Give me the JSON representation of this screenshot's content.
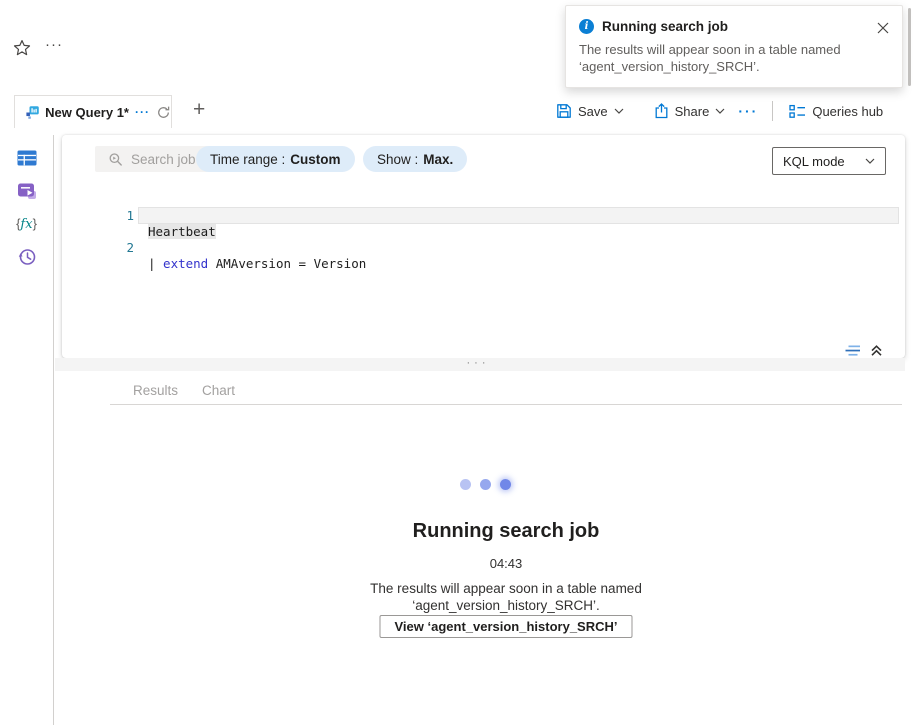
{
  "topbar": {
    "more": "···"
  },
  "toast": {
    "title": "Running search job",
    "line1": "The results will appear soon in a table named",
    "line2": "‘agent_version_history_SRCH’."
  },
  "tabbar": {
    "tab_label": "New Query 1*",
    "tab_more": "···",
    "new_tab": "+"
  },
  "toolbar": {
    "save": "Save",
    "share": "Share",
    "more": "···",
    "queries_hub": "Queries hub"
  },
  "querybar": {
    "search_job": "Search job",
    "time_range_label": "Time range :",
    "time_range_value": "Custom",
    "show_label": "Show :",
    "show_value": "Max.",
    "mode": "KQL mode"
  },
  "rail": {
    "fx_open": "{",
    "fx": "fx",
    "fx_close": "}"
  },
  "editor": {
    "line1_num": "1",
    "line1_text": "Heartbeat",
    "line2_num": "2",
    "line2_pipe": "|",
    "line2_keyword": " extend",
    "line2_rest": " AMAversion = Version"
  },
  "splitter": {
    "handle": "···"
  },
  "results": {
    "tab_results": "Results",
    "tab_chart": "Chart",
    "title": "Running search job",
    "elapsed": "04:43",
    "line1": "The results will appear soon in a table named",
    "line2": "‘agent_version_history_SRCH’.",
    "view_button": "View ‘agent_version_history_SRCH’"
  },
  "colors": {
    "accent": "#0078d4",
    "pill_bg": "#deecf9",
    "keyword": "#3333cc",
    "line_number": "#237893",
    "loading_dots": [
      "#b8c3f3",
      "#96a8ee",
      "#7187e8"
    ]
  }
}
